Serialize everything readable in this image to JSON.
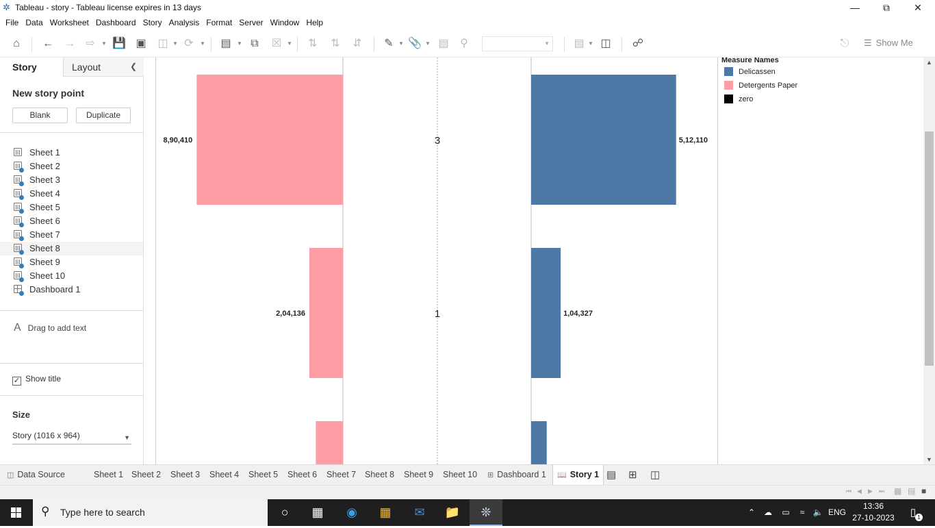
{
  "window": {
    "title": "Tableau - story - Tableau license expires in 13 days",
    "app_icon": "tableau-logo-icon",
    "controls": [
      "minimize-icon",
      "restore-icon",
      "close-icon"
    ]
  },
  "menu": [
    "File",
    "Data",
    "Worksheet",
    "Dashboard",
    "Story",
    "Analysis",
    "Format",
    "Server",
    "Window",
    "Help"
  ],
  "toolbar": {
    "show_me_label": "Show Me"
  },
  "left_panel": {
    "tabs": {
      "story": "Story",
      "layout": "Layout"
    },
    "new_story_point": "New story point",
    "blank_label": "Blank",
    "duplicate_label": "Duplicate",
    "sheets": [
      "Sheet 1",
      "Sheet 2",
      "Sheet 3",
      "Sheet 4",
      "Sheet 5",
      "Sheet 6",
      "Sheet 7",
      "Sheet 8",
      "Sheet 9",
      "Sheet 10",
      "Dashboard 1"
    ],
    "drag_text": "Drag to add text",
    "show_title": "Show title",
    "show_title_checked": true,
    "size_title": "Size",
    "size_value": "Story (1016 x 964)"
  },
  "legend": {
    "title": "Measure Names",
    "items": [
      {
        "label": "Delicassen",
        "color": "#4e79a7"
      },
      {
        "label": "Detergents Paper",
        "color": "#ff9da7"
      },
      {
        "label": "zero",
        "color": "#000000"
      }
    ]
  },
  "chart_data": {
    "type": "bar",
    "layout": "back-to-back horizontal bars",
    "categories": [
      "3",
      "1",
      ""
    ],
    "series": [
      {
        "name": "Detergents Paper",
        "color": "#ff9da7",
        "values": [
          890410,
          204136,
          165000
        ],
        "labels": [
          "8,90,410",
          "2,04,136",
          ""
        ]
      },
      {
        "name": "Delicassen",
        "color": "#4e79a7",
        "values": [
          512110,
          104327,
          55000
        ],
        "labels": [
          "5,12,110",
          "1,04,327",
          ""
        ]
      }
    ]
  },
  "bottom_tabs": {
    "data_source": "Data Source",
    "sheets": [
      "Sheet 1",
      "Sheet 2",
      "Sheet 3",
      "Sheet 4",
      "Sheet 5",
      "Sheet 6",
      "Sheet 7",
      "Sheet 8",
      "Sheet 9",
      "Sheet 10"
    ],
    "dashboard": "Dashboard 1",
    "story": "Story 1"
  },
  "taskbar": {
    "search_placeholder": "Type here to search",
    "language": "ENG",
    "time": "13:36",
    "date": "27-10-2023",
    "notification_count": "1"
  }
}
